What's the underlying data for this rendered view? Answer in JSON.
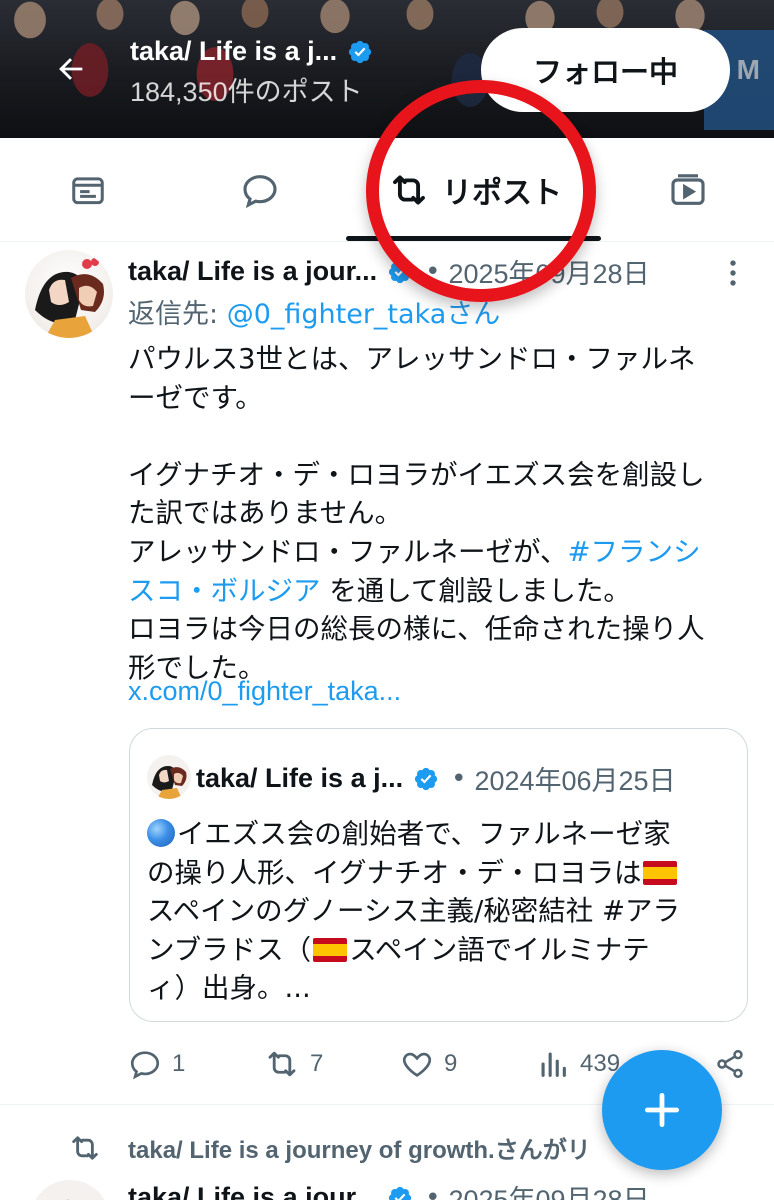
{
  "header": {
    "name": "taka/ Life is a j...",
    "post_count": "184,350件のポスト",
    "follow_label": "フォロー中",
    "banner_overlay_text": "M"
  },
  "tabs": [
    {
      "icon": "article-icon"
    },
    {
      "icon": "reply-bubble-icon"
    },
    {
      "icon": "repost-icon",
      "label": "リポスト",
      "active": true
    },
    {
      "icon": "video-icon"
    }
  ],
  "post": {
    "author": "taka/ Life is a jour...",
    "dot": "•",
    "date": "2025年09月28日",
    "reply_prefix": "返信先: ",
    "reply_handle": "@0_fighter_takaさん",
    "text_lines": {
      "l1": "パウルス3世とは、アレッサンドロ・ファルネ",
      "l2": "ーゼです。",
      "l3": "イグナチオ・デ・ロヨラがイエズス会を創設し",
      "l4": "た訳ではありません。",
      "l5": "アレッサンドロ・ファルネーゼが、",
      "l5_hashtag": "#フランシ",
      "l6_hashtag": "スコ・ボルジア",
      "l6_rest": " を通して創設しました。",
      "l7": "ロヨラは今日の総長の様に、任命された操り人",
      "l8": "形でした。"
    },
    "url": "x.com/0_fighter_taka...",
    "quote": {
      "author": "taka/ Life is a j...",
      "dot": "•",
      "date": "2024年06月25日",
      "l1": "イエズス会の創始者で、ファルネーゼ家",
      "l2a": "の操り人形、イグナチオ・デ・ロヨラは",
      "l3": "スペインのグノーシス主義/秘密結社 #アラ",
      "l4a": "ンブラドス（",
      "l4b": "スペイン語でイルミナテ",
      "l5": "ィ）出身。..."
    },
    "actions": {
      "replies": "1",
      "reposts": "7",
      "likes": "9",
      "views": "439"
    }
  },
  "next_post": {
    "repost_by": "taka/ Life is a journey of growth.さんがリ",
    "author": "taka/ Life is a jour...",
    "dot": "•",
    "date": "2025年09月28日"
  },
  "colors": {
    "accent": "#1d9bf0",
    "text": "#0f1419",
    "muted": "#536471",
    "annotation_ring": "#e8141c"
  }
}
